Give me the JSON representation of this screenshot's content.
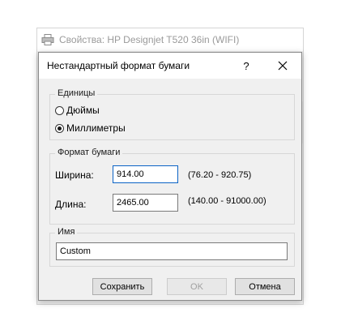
{
  "parent_window": {
    "title": "Свойства: HP Designjet T520 36in (WIFI)"
  },
  "dialog": {
    "title": "Нестандартный формат бумаги",
    "help_label": "?",
    "units": {
      "group_label": "Единицы",
      "options": [
        {
          "label": "Дюймы",
          "checked": false
        },
        {
          "label": "Миллиметры",
          "checked": true
        }
      ]
    },
    "paper_format": {
      "group_label": "Формат бумаги",
      "width_label": "Ширина:",
      "width_value": "914.00",
      "width_range": "(76.20 - 920.75)",
      "length_label": "Длина:",
      "length_value": "2465.00",
      "length_range": "(140.00 - 91000.00)"
    },
    "name": {
      "group_label": "Имя",
      "value": "Custom"
    },
    "buttons": {
      "save": "Сохранить",
      "ok": "OK",
      "cancel": "Отмена"
    }
  }
}
